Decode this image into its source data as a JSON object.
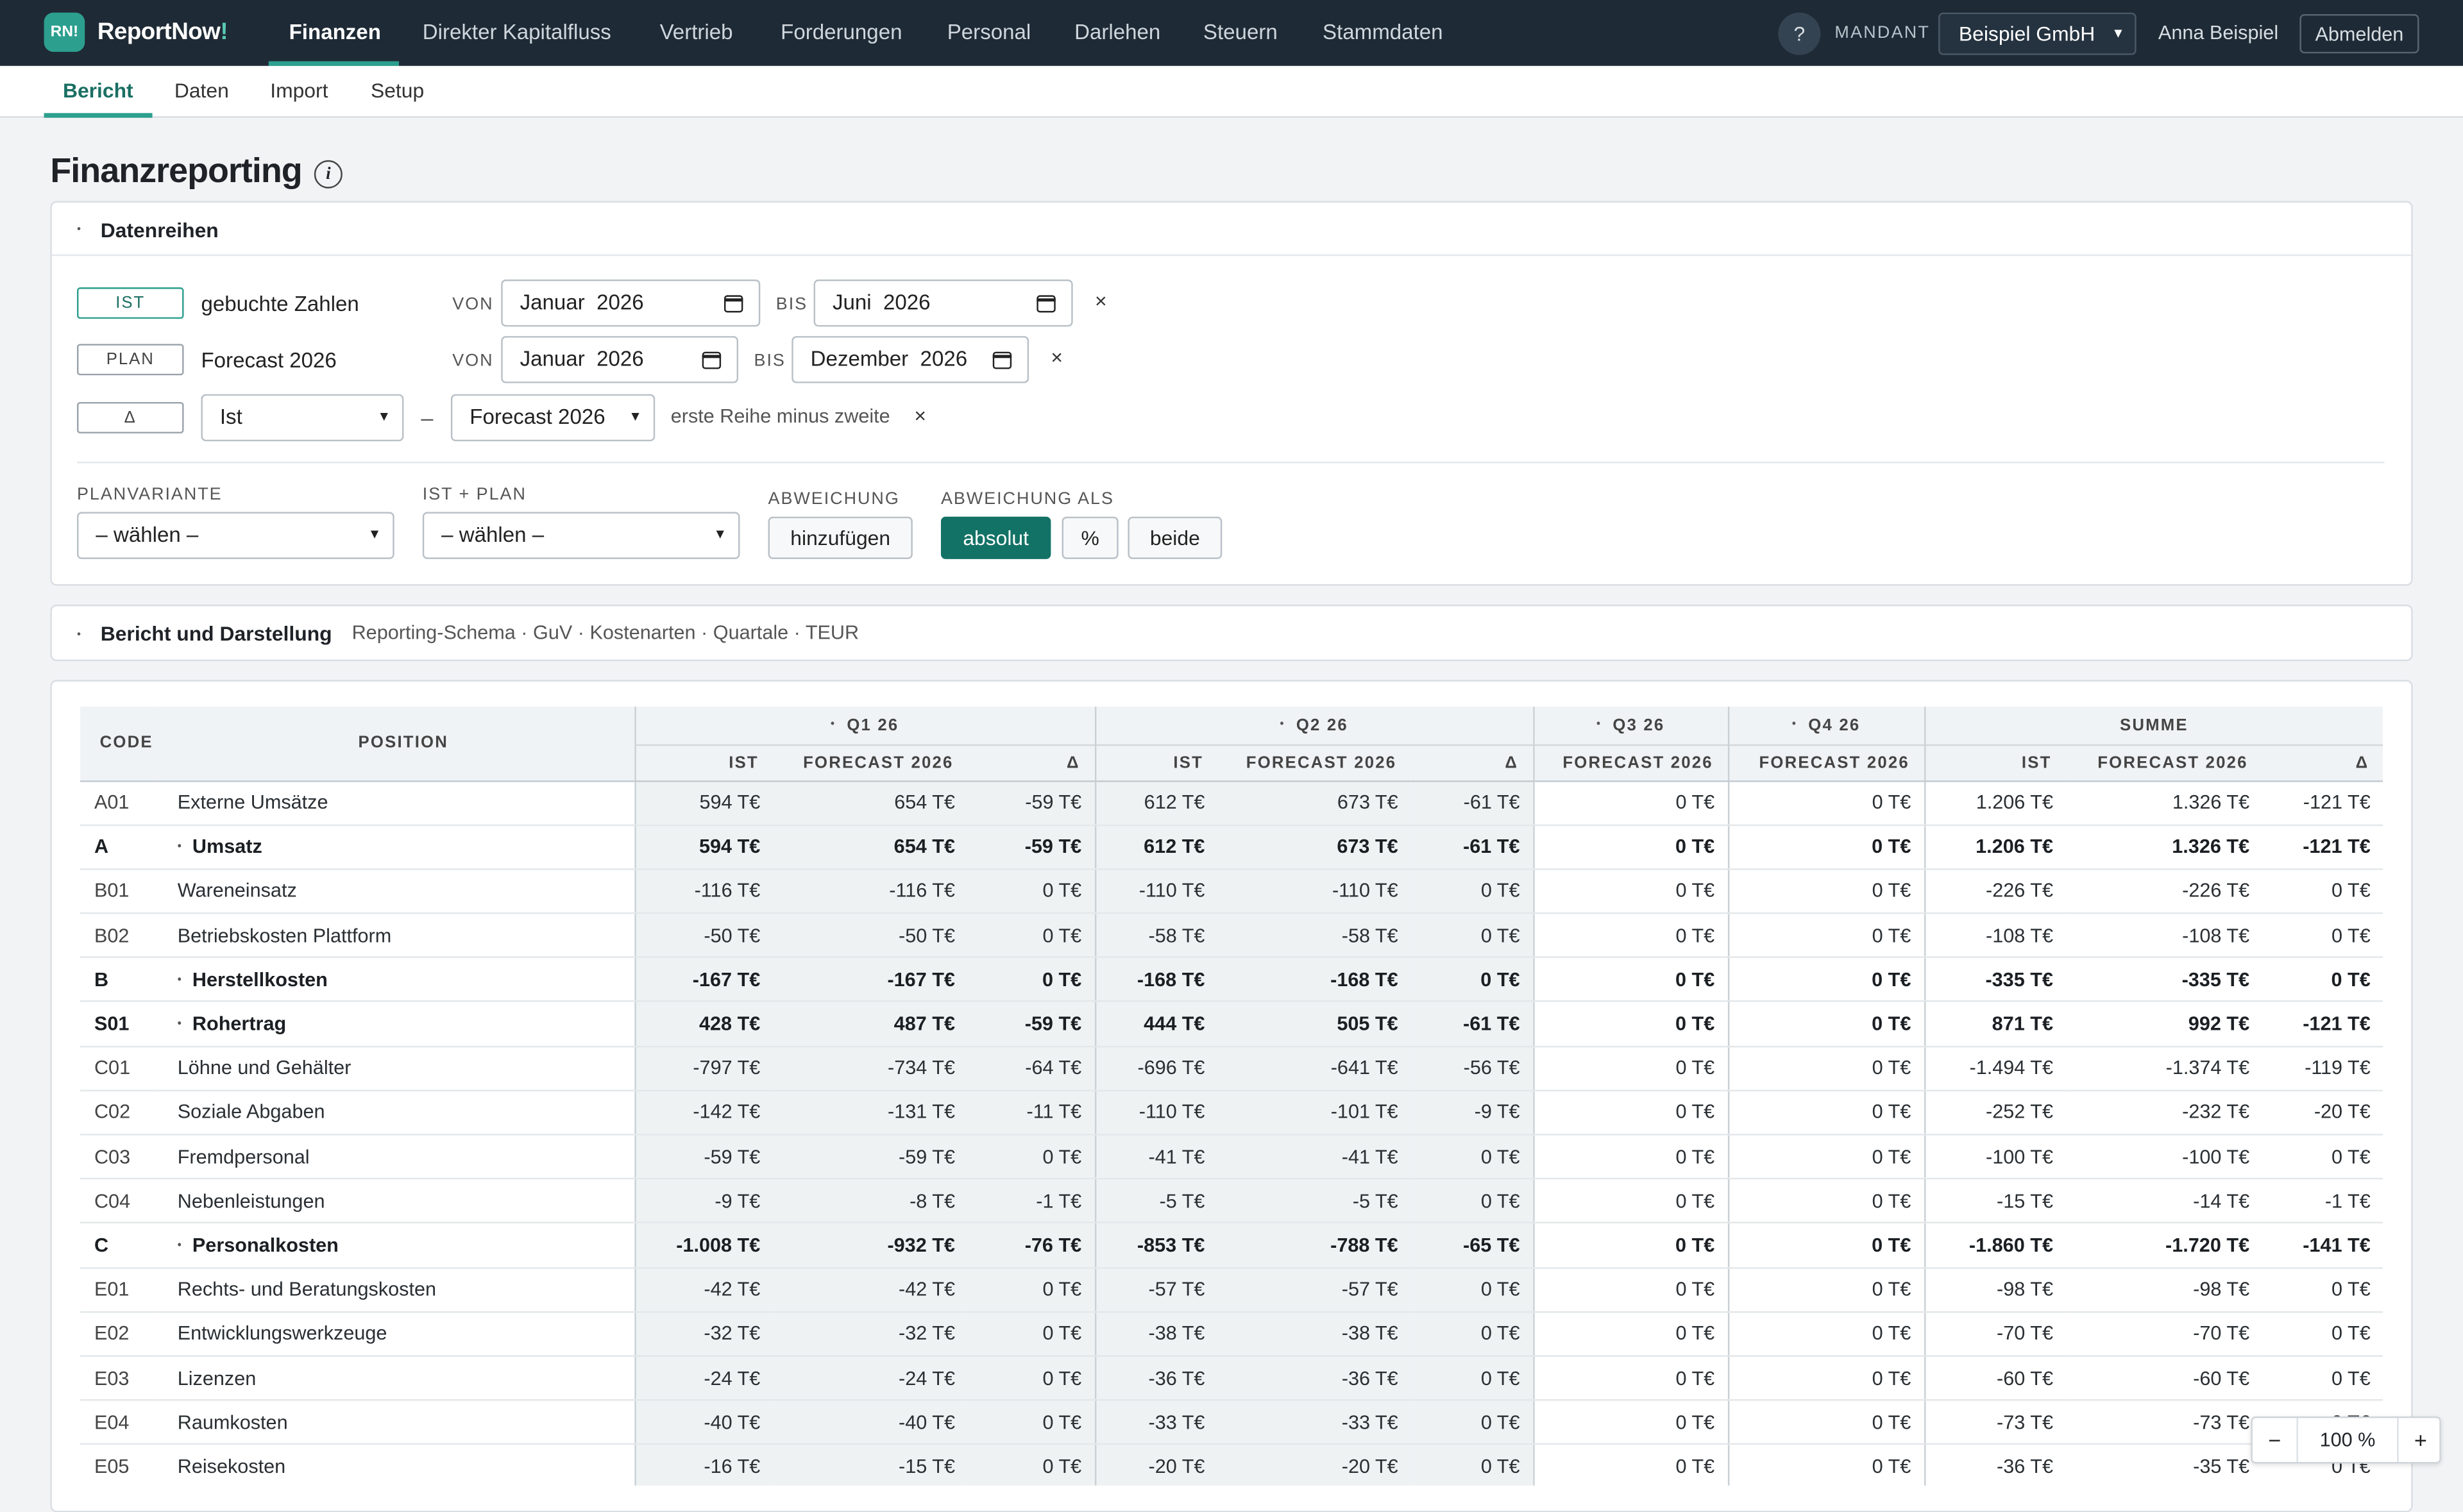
{
  "app": {
    "logo_badge": "RN!",
    "logo_text": "ReportNow",
    "logo_bang": "!"
  },
  "nav": {
    "items": [
      "Finanzen",
      "Direkter Kapitalfluss",
      "Vertrieb",
      "Forderungen",
      "Personal",
      "Darlehen",
      "Steuern",
      "Stammdaten"
    ],
    "active": "Finanzen",
    "help_label": "?",
    "mandant_label": "MANDANT",
    "mandant_value": "Beispiel GmbH",
    "user": "Anna Beispiel",
    "logout": "Abmelden"
  },
  "subnav": {
    "items": [
      "Bericht",
      "Daten",
      "Import",
      "Setup"
    ],
    "active": "Bericht"
  },
  "page": {
    "title": "Finanzreporting",
    "info_icon": "info-icon"
  },
  "datenreihen": {
    "title": "Datenreihen",
    "rows": [
      {
        "tag": "IST",
        "label": "gebuchte Zahlen",
        "von_label": "VON",
        "von": "Januar  2026",
        "bis_label": "BIS",
        "bis": "Juni  2026"
      },
      {
        "tag": "PLAN",
        "label": "Forecast 2026",
        "von_label": "VON",
        "von": "Januar  2026",
        "bis_label": "BIS",
        "bis": "Dezember  2026"
      }
    ],
    "delta": {
      "tag": "Δ",
      "first": "Ist",
      "minus": "–",
      "second": "Forecast 2026",
      "hint": "erste Reihe minus zweite"
    },
    "remove_glyph": "×",
    "planvariante": {
      "label": "PLANVARIANTE",
      "value": "– wählen –"
    },
    "ist_plan": {
      "label": "IST + PLAN",
      "value": "– wählen –"
    },
    "abweichung": {
      "label": "ABWEICHUNG",
      "button": "hinzufügen"
    },
    "abweichung_als": {
      "label": "ABWEICHUNG ALS",
      "options": [
        "absolut",
        "%",
        "beide"
      ],
      "selected": "absolut"
    }
  },
  "bericht": {
    "title": "Bericht und Darstellung",
    "subtitle": "Reporting-Schema · GuV · Kostenarten · Quartale · TEUR"
  },
  "table": {
    "col_code": "CODE",
    "col_position": "POSITION",
    "groups": [
      "Q1 26",
      "Q2 26",
      "Q3 26",
      "Q4 26",
      "SUMME"
    ],
    "subheaders": {
      "q1": [
        "IST",
        "FORECAST 2026",
        "Δ"
      ],
      "q2": [
        "IST",
        "FORECAST 2026",
        "Δ"
      ],
      "q3": [
        "FORECAST 2026"
      ],
      "q4": [
        "FORECAST 2026"
      ],
      "sum": [
        "IST",
        "FORECAST 2026",
        "Δ"
      ]
    },
    "rows": [
      {
        "code": "A01",
        "pos": "Externe Umsätze",
        "bold": false,
        "v": [
          "594 T€",
          "654 T€",
          "-59 T€",
          "612 T€",
          "673 T€",
          "-61 T€",
          "0 T€",
          "0 T€",
          "1.206 T€",
          "1.326 T€",
          "-121 T€"
        ]
      },
      {
        "code": "A",
        "pos": "Umsatz",
        "bold": true,
        "v": [
          "594 T€",
          "654 T€",
          "-59 T€",
          "612 T€",
          "673 T€",
          "-61 T€",
          "0 T€",
          "0 T€",
          "1.206 T€",
          "1.326 T€",
          "-121 T€"
        ]
      },
      {
        "code": "B01",
        "pos": "Wareneinsatz",
        "bold": false,
        "v": [
          "-116 T€",
          "-116 T€",
          "0 T€",
          "-110 T€",
          "-110 T€",
          "0 T€",
          "0 T€",
          "0 T€",
          "-226 T€",
          "-226 T€",
          "0 T€"
        ]
      },
      {
        "code": "B02",
        "pos": "Betriebskosten Plattform",
        "bold": false,
        "v": [
          "-50 T€",
          "-50 T€",
          "0 T€",
          "-58 T€",
          "-58 T€",
          "0 T€",
          "0 T€",
          "0 T€",
          "-108 T€",
          "-108 T€",
          "0 T€"
        ]
      },
      {
        "code": "B",
        "pos": "Herstellkosten",
        "bold": true,
        "v": [
          "-167 T€",
          "-167 T€",
          "0 T€",
          "-168 T€",
          "-168 T€",
          "0 T€",
          "0 T€",
          "0 T€",
          "-335 T€",
          "-335 T€",
          "0 T€"
        ]
      },
      {
        "code": "S01",
        "pos": "Rohertrag",
        "bold": true,
        "v": [
          "428 T€",
          "487 T€",
          "-59 T€",
          "444 T€",
          "505 T€",
          "-61 T€",
          "0 T€",
          "0 T€",
          "871 T€",
          "992 T€",
          "-121 T€"
        ]
      },
      {
        "code": "C01",
        "pos": "Löhne und Gehälter",
        "bold": false,
        "v": [
          "-797 T€",
          "-734 T€",
          "-64 T€",
          "-696 T€",
          "-641 T€",
          "-56 T€",
          "0 T€",
          "0 T€",
          "-1.494 T€",
          "-1.374 T€",
          "-119 T€"
        ]
      },
      {
        "code": "C02",
        "pos": "Soziale Abgaben",
        "bold": false,
        "v": [
          "-142 T€",
          "-131 T€",
          "-11 T€",
          "-110 T€",
          "-101 T€",
          "-9 T€",
          "0 T€",
          "0 T€",
          "-252 T€",
          "-232 T€",
          "-20 T€"
        ]
      },
      {
        "code": "C03",
        "pos": "Fremdpersonal",
        "bold": false,
        "v": [
          "-59 T€",
          "-59 T€",
          "0 T€",
          "-41 T€",
          "-41 T€",
          "0 T€",
          "0 T€",
          "0 T€",
          "-100 T€",
          "-100 T€",
          "0 T€"
        ]
      },
      {
        "code": "C04",
        "pos": "Nebenleistungen",
        "bold": false,
        "v": [
          "-9 T€",
          "-8 T€",
          "-1 T€",
          "-5 T€",
          "-5 T€",
          "0 T€",
          "0 T€",
          "0 T€",
          "-15 T€",
          "-14 T€",
          "-1 T€"
        ]
      },
      {
        "code": "C",
        "pos": "Personalkosten",
        "bold": true,
        "v": [
          "-1.008 T€",
          "-932 T€",
          "-76 T€",
          "-853 T€",
          "-788 T€",
          "-65 T€",
          "0 T€",
          "0 T€",
          "-1.860 T€",
          "-1.720 T€",
          "-141 T€"
        ]
      },
      {
        "code": "E01",
        "pos": "Rechts- und Beratungskosten",
        "bold": false,
        "v": [
          "-42 T€",
          "-42 T€",
          "0 T€",
          "-57 T€",
          "-57 T€",
          "0 T€",
          "0 T€",
          "0 T€",
          "-98 T€",
          "-98 T€",
          "0 T€"
        ]
      },
      {
        "code": "E02",
        "pos": "Entwicklungswerkzeuge",
        "bold": false,
        "v": [
          "-32 T€",
          "-32 T€",
          "0 T€",
          "-38 T€",
          "-38 T€",
          "0 T€",
          "0 T€",
          "0 T€",
          "-70 T€",
          "-70 T€",
          "0 T€"
        ]
      },
      {
        "code": "E03",
        "pos": "Lizenzen",
        "bold": false,
        "v": [
          "-24 T€",
          "-24 T€",
          "0 T€",
          "-36 T€",
          "-36 T€",
          "0 T€",
          "0 T€",
          "0 T€",
          "-60 T€",
          "-60 T€",
          "0 T€"
        ]
      },
      {
        "code": "E04",
        "pos": "Raumkosten",
        "bold": false,
        "v": [
          "-40 T€",
          "-40 T€",
          "0 T€",
          "-33 T€",
          "-33 T€",
          "0 T€",
          "0 T€",
          "0 T€",
          "-73 T€",
          "-73 T€",
          "0 T€"
        ]
      },
      {
        "code": "E05",
        "pos": "Reisekosten",
        "bold": false,
        "v": [
          "-16 T€",
          "-15 T€",
          "0 T€",
          "-20 T€",
          "-20 T€",
          "0 T€",
          "0 T€",
          "0 T€",
          "-36 T€",
          "-35 T€",
          "0 T€"
        ]
      }
    ]
  },
  "zoom": {
    "minus": "−",
    "value": "100 %",
    "plus": "+"
  },
  "colors": {
    "topbar": "#1e2a35",
    "accent": "#2d9f8e",
    "primary_button": "#137266"
  }
}
